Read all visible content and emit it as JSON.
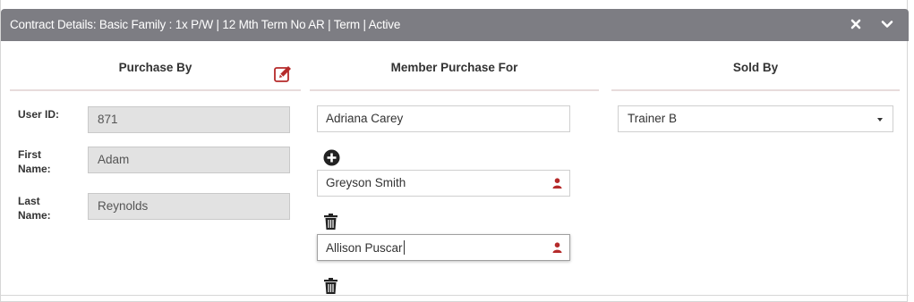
{
  "header": {
    "title": "Contract Details: Basic Family : 1x P/W | 12 Mth Term No AR | Term | Active",
    "close_icon": "close-icon",
    "collapse_icon": "chevron-down-icon"
  },
  "columns": {
    "purchase_by": "Purchase By",
    "member_purchase_for": "Member Purchase For",
    "sold_by": "Sold By"
  },
  "purchase_by": {
    "user_id_label": "User ID:",
    "user_id_value": "871",
    "first_name_label_1": "First",
    "first_name_label_2": "Name:",
    "first_name_value": "Adam",
    "last_name_label_1": "Last",
    "last_name_label_2": "Name:",
    "last_name_value": "Reynolds"
  },
  "members": {
    "primary": "Adriana Carey",
    "additional": [
      "Greyson Smith",
      "Allison Puscar"
    ]
  },
  "sold_by": {
    "selected": "Trainer B"
  },
  "colors": {
    "header_bg": "#7d7d83",
    "accent_red": "#b52a2a"
  }
}
